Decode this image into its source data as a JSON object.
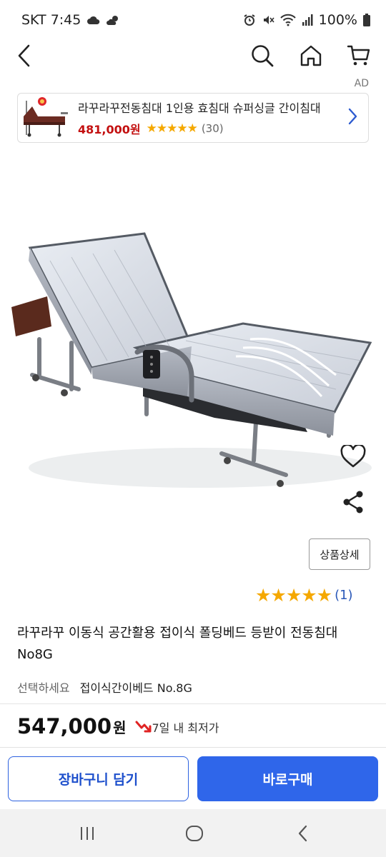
{
  "status": {
    "carrier_time": "SKT 7:45",
    "battery": "100%"
  },
  "nav": {
    "icons": [
      "back-arrow-icon",
      "search-icon",
      "home-icon",
      "cart-icon"
    ]
  },
  "ad": {
    "label": "AD",
    "title": "라꾸라꾸전동침대 1인용 효침대 슈퍼싱글 간이침대",
    "price": "481,000원",
    "stars": "★★★★★",
    "review_count": "(30)"
  },
  "product": {
    "detail_button": "상품상세",
    "rating_stars": "★★★★★",
    "rating_count": "(1)",
    "title": "라꾸라꾸 이동식 공간활용 접이식 폴딩베드 등받이 전동침대 No8G",
    "option_label": "선택하세요",
    "option_value": "접이식간이베드 No.8G",
    "price": "547,000",
    "price_unit": "원",
    "low_price_text": "7일 내 최저가"
  },
  "actions": {
    "cart": "장바구니 담기",
    "buy": "바로구매"
  },
  "colors": {
    "accent": "#2f66ea",
    "price_red": "#c31010",
    "star": "#f5a800",
    "link_blue": "#2a58b8"
  }
}
